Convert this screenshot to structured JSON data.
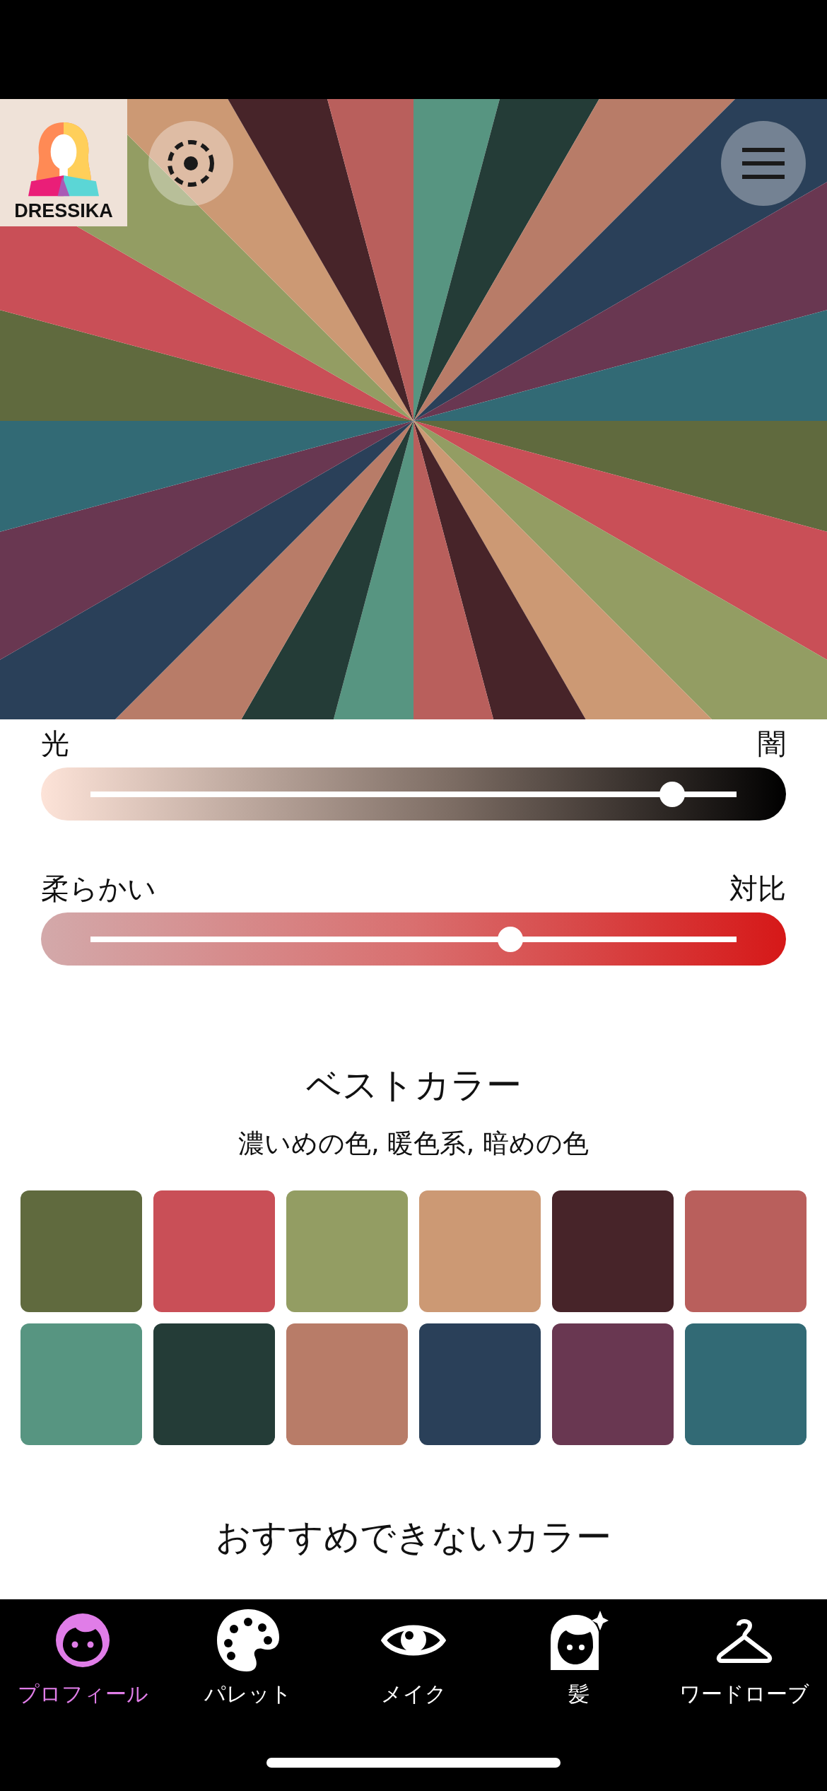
{
  "logo": {
    "text": "DRESSIKA"
  },
  "sliders": [
    {
      "kind": "light-dark",
      "left_label": "光",
      "right_label": "闇",
      "level": 0.9
    },
    {
      "kind": "soft-contrast",
      "left_label": "柔らかい",
      "right_label": "対比",
      "level": 0.65
    }
  ],
  "best_colors": {
    "title": "ベストカラー",
    "subtitle": "濃いめの色, 暖色系, 暗めの色",
    "swatches": [
      {
        "color": "#606a3e"
      },
      {
        "color": "#c94f57"
      },
      {
        "color": "#939d63"
      },
      {
        "color": "#cc9974"
      },
      {
        "color": "#472429"
      },
      {
        "color": "#b95f5c"
      },
      {
        "color": "#579581"
      },
      {
        "color": "#243c37"
      },
      {
        "color": "#b87c68"
      },
      {
        "color": "#2a4059"
      },
      {
        "color": "#693751"
      },
      {
        "color": "#326a75"
      }
    ]
  },
  "not_recommended": {
    "title": "おすすめできないカラー"
  },
  "tab_bar": [
    {
      "kind": "profile",
      "label": "プロフィール",
      "selected": true
    },
    {
      "kind": "palette",
      "label": "パレット",
      "selected": false
    },
    {
      "kind": "makeup",
      "label": "メイク",
      "selected": false
    },
    {
      "kind": "hair",
      "label": "髪",
      "selected": false
    },
    {
      "kind": "wardrobe",
      "label": "ワードローブ",
      "selected": false
    }
  ]
}
